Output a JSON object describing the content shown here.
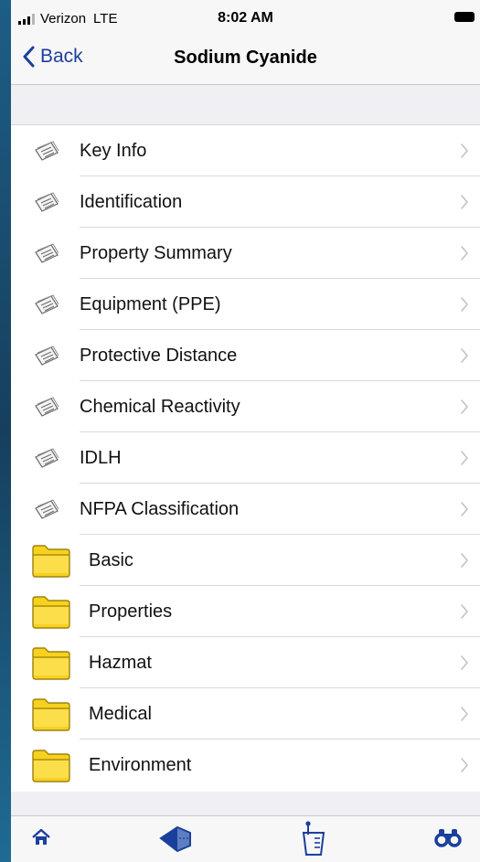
{
  "status_bar": {
    "carrier": "Verizon",
    "network": "LTE",
    "time": "8:02 AM"
  },
  "nav": {
    "back_label": "Back",
    "title": "Sodium Cyanide"
  },
  "items": [
    {
      "label": "Key Info",
      "icon": "document-icon"
    },
    {
      "label": "Identification",
      "icon": "document-icon"
    },
    {
      "label": "Property Summary",
      "icon": "document-icon"
    },
    {
      "label": "Equipment (PPE)",
      "icon": "document-icon"
    },
    {
      "label": "Protective Distance",
      "icon": "document-icon"
    },
    {
      "label": "Chemical Reactivity",
      "icon": "document-icon"
    },
    {
      "label": "IDLH",
      "icon": "document-icon"
    },
    {
      "label": "NFPA Classification",
      "icon": "document-icon"
    },
    {
      "label": "Basic",
      "icon": "folder-icon"
    },
    {
      "label": "Properties",
      "icon": "folder-icon"
    },
    {
      "label": "Hazmat",
      "icon": "folder-icon"
    },
    {
      "label": "Medical",
      "icon": "folder-icon"
    },
    {
      "label": "Environment",
      "icon": "folder-icon"
    }
  ],
  "tab_bar": {
    "tabs": [
      {
        "icon": "home-icon"
      },
      {
        "icon": "map-icon"
      },
      {
        "icon": "beaker-icon"
      },
      {
        "icon": "binoculars-icon"
      }
    ]
  },
  "colors": {
    "accent": "#1b3f9c",
    "folder": "#f7d11e",
    "separator": "#d9d9dd",
    "background": "#efeff4"
  }
}
